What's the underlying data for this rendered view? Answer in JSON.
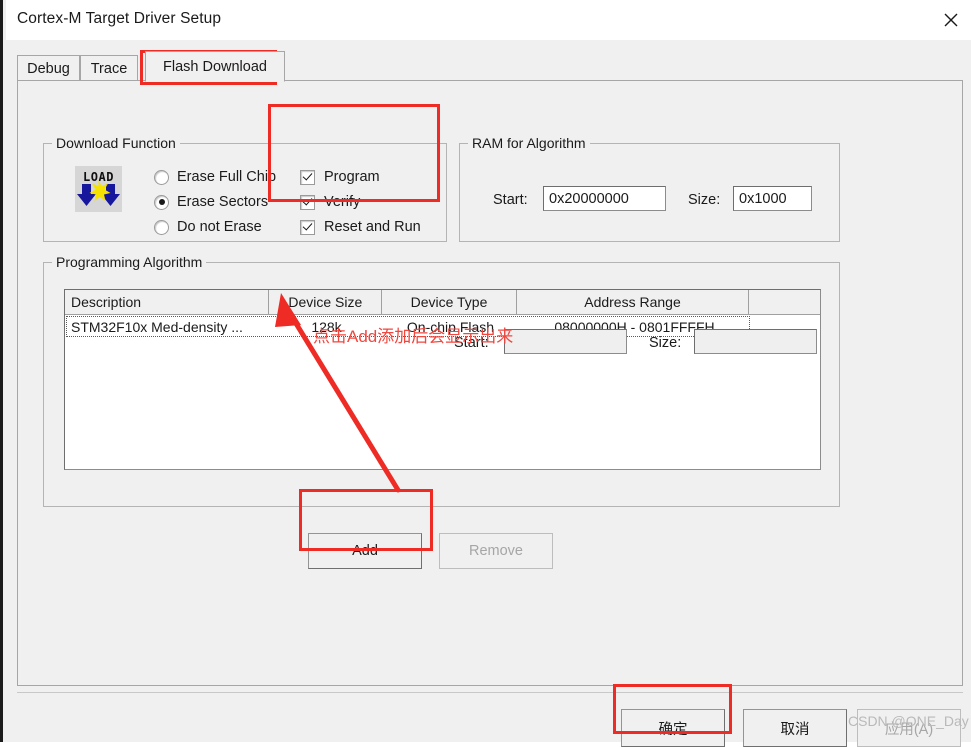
{
  "window": {
    "title": "Cortex-M Target Driver Setup",
    "close_icon": "close-icon"
  },
  "tabs": [
    {
      "label": "Debug",
      "selected": false
    },
    {
      "label": "Trace",
      "selected": false
    },
    {
      "label": "Flash Download",
      "selected": true
    }
  ],
  "download_function": {
    "legend": "Download Function",
    "icon_label": "LOAD",
    "radios": [
      {
        "label": "Erase Full Chip",
        "checked": false
      },
      {
        "label": "Erase Sectors",
        "checked": true
      },
      {
        "label": "Do not Erase",
        "checked": false
      }
    ],
    "checkboxes": [
      {
        "label": "Program",
        "checked": true
      },
      {
        "label": "Verify",
        "checked": true
      },
      {
        "label": "Reset and Run",
        "checked": true
      }
    ]
  },
  "ram_for_algorithm": {
    "legend": "RAM for Algorithm",
    "start_label": "Start:",
    "start_value": "0x20000000",
    "size_label": "Size:",
    "size_value": "0x1000"
  },
  "programming_algorithm": {
    "legend": "Programming Algorithm",
    "columns": [
      "Description",
      "Device Size",
      "Device Type",
      "Address Range",
      ""
    ],
    "rows": [
      {
        "description": "STM32F10x Med-density ...",
        "device_size": "128k",
        "device_type": "On-chip Flash",
        "address_range": "08000000H - 0801FFFFH"
      }
    ],
    "start_label": "Start:",
    "start_value": "",
    "size_label": "Size:",
    "size_value": "",
    "add_button": "Add",
    "remove_button": "Remove"
  },
  "dialog_buttons": {
    "ok": "确定",
    "cancel": "取消",
    "apply": "应用(A)"
  },
  "annotations": {
    "note_text": "点击Add添加后会显示出来",
    "highlight_color": "#ee2b24",
    "note_color": "#f0473f"
  },
  "watermark": "CSDN @ONE_Day"
}
